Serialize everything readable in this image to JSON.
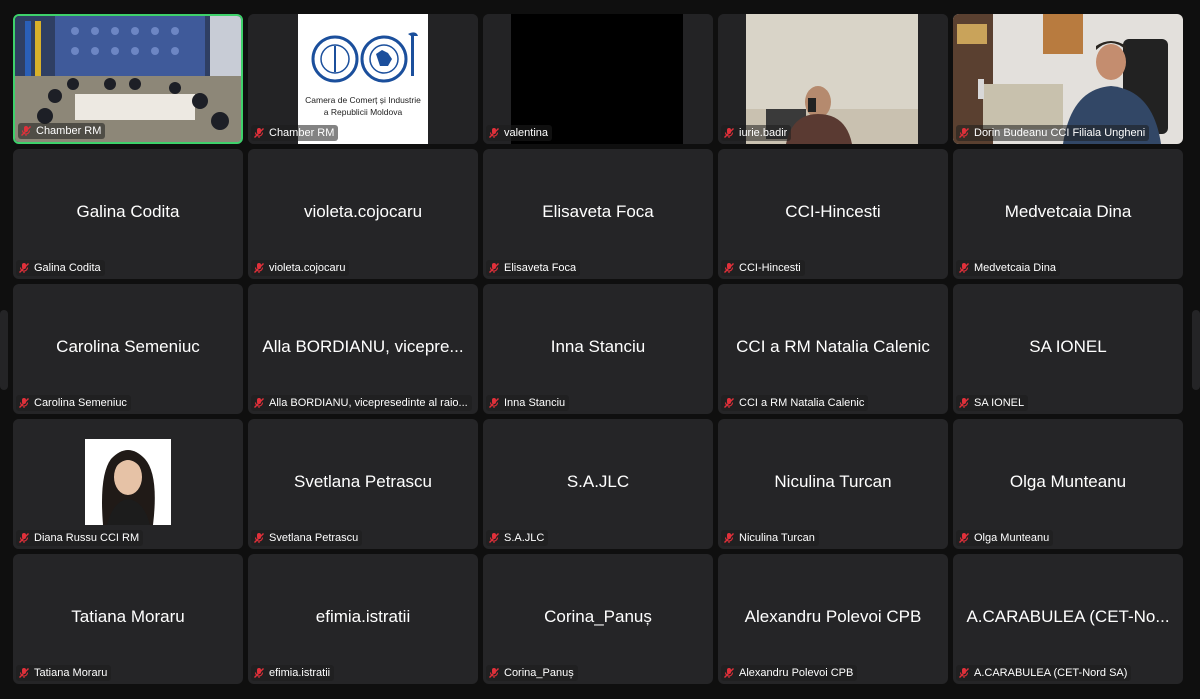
{
  "participants": [
    {
      "name": "Chamber RM",
      "video": "meeting-room",
      "active": true
    },
    {
      "name": "Chamber RM",
      "video": "logo"
    },
    {
      "name": "valentina",
      "video": "black"
    },
    {
      "name": "iurie.badir",
      "video": "man-phone"
    },
    {
      "name": "Dorin Budeanu CCI Filiala Ungheni",
      "video": "office-man"
    },
    {
      "name": "Galina Codita",
      "display": "Galina Codita"
    },
    {
      "name": "violeta.cojocaru",
      "display": "violeta.cojocaru"
    },
    {
      "name": "Elisaveta Foca",
      "display": "Elisaveta Foca"
    },
    {
      "name": "CCI-Hincesti",
      "display": "CCI-Hincesti"
    },
    {
      "name": "Medvetcaia Dina",
      "display": "Medvetcaia Dina"
    },
    {
      "name": "Carolina Semeniuc",
      "display": "Carolina Semeniuc"
    },
    {
      "name": "Alla BORDIANU, vicepresedinte al raio...",
      "display": "Alla BORDIANU, vicepre..."
    },
    {
      "name": "Inna Stanciu",
      "display": "Inna Stanciu"
    },
    {
      "name": "CCI a RM Natalia Calenic",
      "display": "CCI a RM Natalia Calenic"
    },
    {
      "name": "SA IONEL",
      "display": "SA IONEL"
    },
    {
      "name": "Diana Russu CCI RM",
      "video": "portrait"
    },
    {
      "name": "Svetlana Petrascu",
      "display": "Svetlana Petrascu"
    },
    {
      "name": "S.A.JLC",
      "display": "S.A.JLC"
    },
    {
      "name": "Niculina Turcan",
      "display": "Niculina Turcan"
    },
    {
      "name": "Olga Munteanu",
      "display": "Olga Munteanu"
    },
    {
      "name": "Tatiana Moraru",
      "display": "Tatiana Moraru"
    },
    {
      "name": "efimia.istratii",
      "display": "efimia.istratii"
    },
    {
      "name": "Corina_Panuș",
      "display": "Corina_Panuș"
    },
    {
      "name": "Alexandru Polevoi CPB",
      "display": "Alexandru Polevoi CPB"
    },
    {
      "name": "A.CARABULEA (CET-Nord SA)",
      "display": "A.CARABULEA (CET-No..."
    }
  ],
  "logo": {
    "line1": "Camera de Comerț și Industrie",
    "line2": "a Republicii Moldova",
    "color": "#1b4f9c"
  },
  "colors": {
    "tile": "#252527",
    "background": "#0f0f0f",
    "active_border": "#3ed16b",
    "mic_muted": "#e0303a"
  },
  "icons": {
    "mic": "mic-muted-icon"
  }
}
